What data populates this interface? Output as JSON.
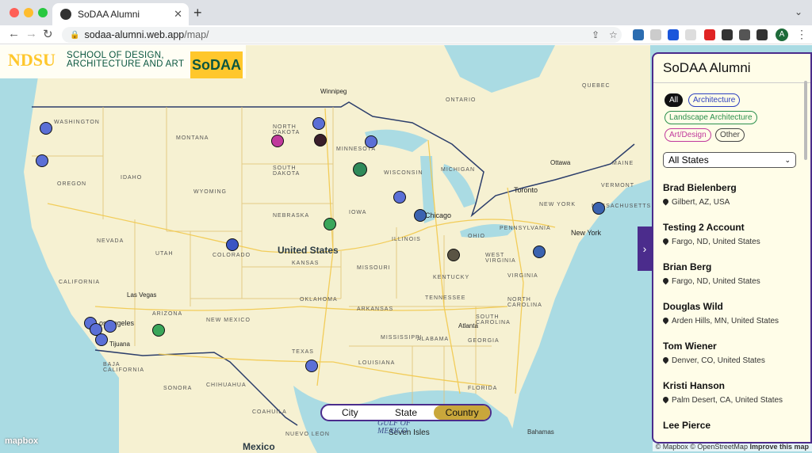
{
  "browser": {
    "tab_title": "SoDAA Alumni",
    "url_host": "sodaa-alumni.web.app",
    "url_path": "/map/",
    "avatar_initial": "A"
  },
  "logo": {
    "ndsu": "NDSU",
    "school_line1": "SCHOOL OF DESIGN,",
    "school_line2": "ARCHITECTURE AND ART",
    "badge": "SoDAA"
  },
  "map": {
    "country_label": "United States",
    "mexico_label": "Mexico",
    "gulf_line1": "GULF OF",
    "gulf_line2": "MEXICO",
    "bahamas": "Bahamas",
    "mapbox_logo": "mapbox",
    "attribution": "© Mapbox © OpenStreetMap",
    "improve": "Improve this map",
    "states": [
      "WASHINGTON",
      "MONTANA",
      "NORTH DAKOTA",
      "MINNESOTA",
      "OREGON",
      "IDAHO",
      "SOUTH DAKOTA",
      "WYOMING",
      "WISCONSIN",
      "MICHIGAN",
      "NEBRASKA",
      "IOWA",
      "NEVADA",
      "UTAH",
      "COLORADO",
      "KANSAS",
      "ILLINOIS",
      "OHIO",
      "MISSOURI",
      "CALIFORNIA",
      "KENTUCKY",
      "ARIZONA",
      "NEW MEXICO",
      "OKLAHOMA",
      "ARKANSAS",
      "TENNESSEE",
      "TEXAS",
      "MISSISSIPPI",
      "ALABAMA",
      "GEORGIA",
      "LOUISIANA",
      "VIRGINIA",
      "PENNSYLVANIA",
      "NEW YORK",
      "QUEBEC",
      "ONTARIO",
      "SONORA",
      "CHIHUAHUA",
      "COAHUILA",
      "NUEVO LEON",
      "FLORIDA",
      "BAJA CALIFORNIA",
      "WEST VIRGINIA",
      "NORTH CAROLINA",
      "SOUTH CAROLINA",
      "MASSACHUSETTS",
      "MAINE",
      "VERMONT"
    ],
    "cities": [
      "Winnipeg",
      "Chicago",
      "Toronto",
      "Ottawa",
      "New York",
      "Las Vegas",
      "Los Angeles",
      "Tijuana",
      "Atlanta",
      "Seven Isles"
    ]
  },
  "toggle": {
    "options": [
      "City",
      "State",
      "Country"
    ],
    "active": "Country"
  },
  "panel": {
    "toggle_icon": "chevron-right-icon",
    "title": "SoDAA Alumni",
    "filters": [
      "All",
      "Architecture",
      "Landscape Architecture",
      "Art/Design",
      "Other"
    ],
    "state_select": "All States",
    "people": [
      {
        "name": "Brad Bielenberg",
        "location": "Gilbert, AZ, USA"
      },
      {
        "name": "Testing 2 Account",
        "location": "Fargo, ND, United States"
      },
      {
        "name": "Brian Berg",
        "location": "Fargo, ND, United States"
      },
      {
        "name": "Douglas Wild",
        "location": "Arden Hills, MN, United States"
      },
      {
        "name": "Tom Wiener",
        "location": "Denver, CO, United States"
      },
      {
        "name": "Kristi Hanson",
        "location": "Palm Desert, CA, United States"
      },
      {
        "name": "Lee Pierce",
        "location": ""
      }
    ]
  },
  "colors": {
    "purple": "#4b2c8c",
    "gold": "#c9a73b",
    "marker_blue": "#5b6fd6",
    "marker_green": "#3aa65a",
    "marker_dark": "#3a1f2b",
    "marker_magenta": "#c0399c",
    "marker_olive": "#5a5444",
    "water": "#aadbe3",
    "land": "#f6f1d2"
  }
}
